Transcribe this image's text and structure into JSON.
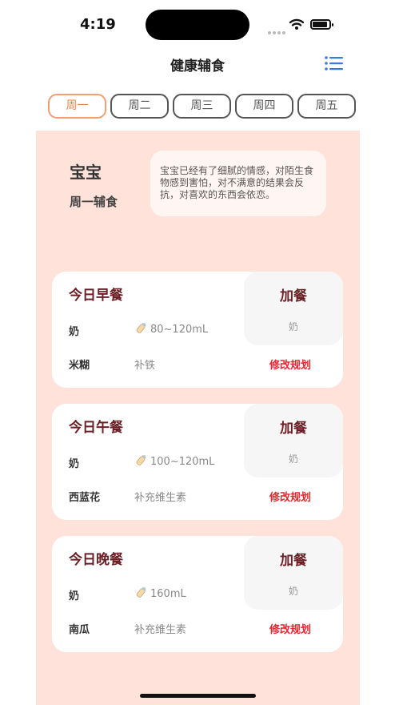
{
  "status_bar": {
    "time": "4:19"
  },
  "nav": {
    "title": "健康辅食",
    "menu_icon": "list-icon",
    "accent_color": "#3a7bd5"
  },
  "tabs": [
    {
      "label": "周一",
      "active": true
    },
    {
      "label": "周二",
      "active": false
    },
    {
      "label": "周三",
      "active": false
    },
    {
      "label": "周四",
      "active": false
    },
    {
      "label": "周五",
      "active": false
    }
  ],
  "profile": {
    "name": "宝宝",
    "subtitle": "周一辅食",
    "note": "宝宝已经有了细腻的情感，对陌生食物感到害怕，对不满意的结果会反抗，对喜欢的东西会依恋。"
  },
  "meals": [
    {
      "title": "今日早餐",
      "milk_label": "奶",
      "milk_amount": "80~120mL",
      "food": "米糊",
      "food_note": "补铁",
      "extra_title": "加餐",
      "extra_item": "奶",
      "edit_label": "修改规划"
    },
    {
      "title": "今日午餐",
      "milk_label": "奶",
      "milk_amount": "100~120mL",
      "food": "西蓝花",
      "food_note": "补充维生素",
      "extra_title": "加餐",
      "extra_item": "奶",
      "edit_label": "修改规划"
    },
    {
      "title": "今日晚餐",
      "milk_label": "奶",
      "milk_amount": "160mL",
      "food": "南瓜",
      "food_note": "补充维生素",
      "extra_title": "加餐",
      "extra_item": "奶",
      "edit_label": "修改规划"
    }
  ],
  "colors": {
    "panel_bg": "#ffe3db",
    "title_dark_red": "#6b1f25",
    "edit_red": "#e8262e",
    "active_tab": "#f08040"
  }
}
